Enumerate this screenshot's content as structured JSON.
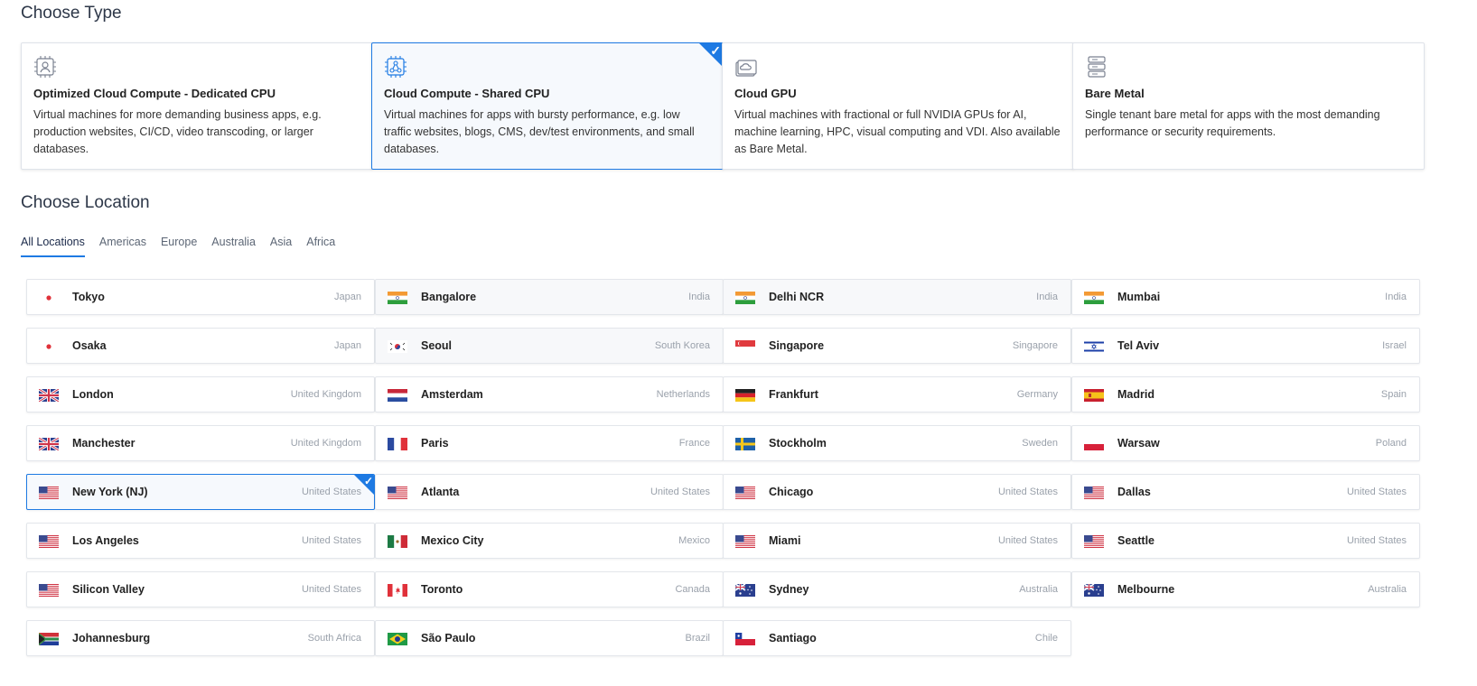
{
  "type_section": {
    "title": "Choose Type",
    "cards": [
      {
        "icon": "chip-user-icon",
        "title": "Optimized Cloud Compute - Dedicated CPU",
        "description": "Virtual machines for more demanding business apps, e.g. production websites, CI/CD, video transcoding, or larger databases.",
        "selected": false
      },
      {
        "icon": "chip-share-icon",
        "title": "Cloud Compute - Shared CPU",
        "description": "Virtual machines for apps with bursty performance, e.g. low traffic websites, blogs, CMS, dev/test environments, and small databases.",
        "selected": true
      },
      {
        "icon": "gpu-cloud-icon",
        "title": "Cloud GPU",
        "description": "Virtual machines with fractional or full NVIDIA GPUs for AI, machine learning, HPC, visual computing and VDI. Also available as Bare Metal.",
        "selected": false
      },
      {
        "icon": "server-rack-icon",
        "title": "Bare Metal",
        "description": "Single tenant bare metal for apps with the most demanding performance or security requirements.",
        "selected": false
      }
    ]
  },
  "location_section": {
    "title": "Choose Location",
    "tabs": [
      {
        "label": "All Locations",
        "active": true
      },
      {
        "label": "Americas",
        "active": false
      },
      {
        "label": "Europe",
        "active": false
      },
      {
        "label": "Australia",
        "active": false
      },
      {
        "label": "Asia",
        "active": false
      },
      {
        "label": "Africa",
        "active": false
      }
    ],
    "locations": [
      {
        "city": "Tokyo",
        "country": "Japan",
        "flag": "jp"
      },
      {
        "city": "Bangalore",
        "country": "India",
        "flag": "in"
      },
      {
        "city": "Delhi NCR",
        "country": "India",
        "flag": "in"
      },
      {
        "city": "Mumbai",
        "country": "India",
        "flag": "in"
      },
      {
        "city": "Osaka",
        "country": "Japan",
        "flag": "jp"
      },
      {
        "city": "Seoul",
        "country": "South Korea",
        "flag": "kr"
      },
      {
        "city": "Singapore",
        "country": "Singapore",
        "flag": "sg"
      },
      {
        "city": "Tel Aviv",
        "country": "Israel",
        "flag": "il"
      },
      {
        "city": "London",
        "country": "United Kingdom",
        "flag": "gb"
      },
      {
        "city": "Amsterdam",
        "country": "Netherlands",
        "flag": "nl"
      },
      {
        "city": "Frankfurt",
        "country": "Germany",
        "flag": "de"
      },
      {
        "city": "Madrid",
        "country": "Spain",
        "flag": "es"
      },
      {
        "city": "Manchester",
        "country": "United Kingdom",
        "flag": "gb"
      },
      {
        "city": "Paris",
        "country": "France",
        "flag": "fr"
      },
      {
        "city": "Stockholm",
        "country": "Sweden",
        "flag": "se"
      },
      {
        "city": "Warsaw",
        "country": "Poland",
        "flag": "pl"
      },
      {
        "city": "New York (NJ)",
        "country": "United States",
        "flag": "us",
        "selected": true
      },
      {
        "city": "Atlanta",
        "country": "United States",
        "flag": "us"
      },
      {
        "city": "Chicago",
        "country": "United States",
        "flag": "us"
      },
      {
        "city": "Dallas",
        "country": "United States",
        "flag": "us"
      },
      {
        "city": "Los Angeles",
        "country": "United States",
        "flag": "us"
      },
      {
        "city": "Mexico City",
        "country": "Mexico",
        "flag": "mx"
      },
      {
        "city": "Miami",
        "country": "United States",
        "flag": "us"
      },
      {
        "city": "Seattle",
        "country": "United States",
        "flag": "us"
      },
      {
        "city": "Silicon Valley",
        "country": "United States",
        "flag": "us"
      },
      {
        "city": "Toronto",
        "country": "Canada",
        "flag": "ca"
      },
      {
        "city": "Sydney",
        "country": "Australia",
        "flag": "au"
      },
      {
        "city": "Melbourne",
        "country": "Australia",
        "flag": "au"
      },
      {
        "city": "Johannesburg",
        "country": "South Africa",
        "flag": "za"
      },
      {
        "city": "São Paulo",
        "country": "Brazil",
        "flag": "br"
      },
      {
        "city": "Santiago",
        "country": "Chile",
        "flag": "cl"
      }
    ]
  },
  "colors": {
    "accent": "#1e7ae3",
    "border": "#dfe3ea",
    "muted": "#9aa1ab"
  }
}
